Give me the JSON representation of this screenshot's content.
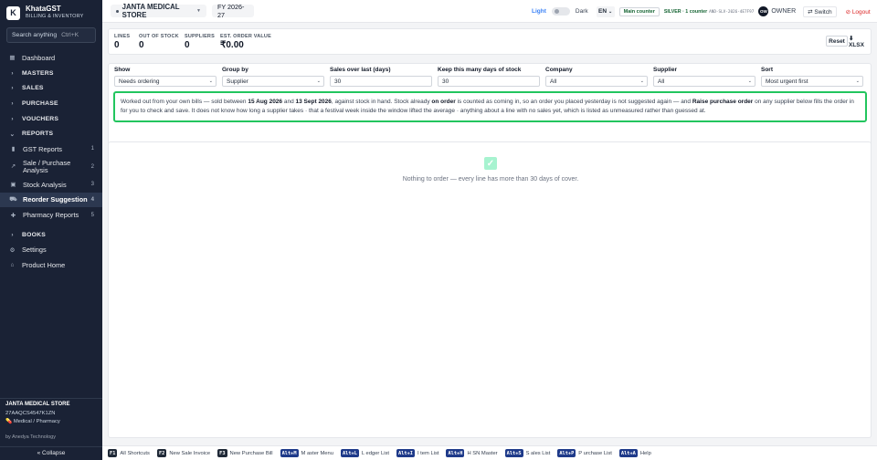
{
  "brand": {
    "logo": "K",
    "name": "KhataGST",
    "subtitle": "BILLING & INVENTORY"
  },
  "sidebar": {
    "search_placeholder": "Search anything",
    "search_shortcut": "Ctrl+K",
    "items": [
      {
        "label": "Dashboard",
        "icon": "grid-icon"
      },
      {
        "label": "MASTERS",
        "icon": "chevron-right-icon"
      },
      {
        "label": "SALES",
        "icon": "chevron-right-icon"
      },
      {
        "label": "PURCHASE",
        "icon": "chevron-right-icon"
      },
      {
        "label": "VOUCHERS",
        "icon": "chevron-right-icon"
      },
      {
        "label": "REPORTS",
        "icon": "chevron-down-icon"
      },
      {
        "label": "GST Reports",
        "count": "1",
        "icon": "bar-chart-icon"
      },
      {
        "label": "Sale / Purchase Analysis",
        "count": "2",
        "icon": "trend-icon"
      },
      {
        "label": "Stock Analysis",
        "count": "3",
        "icon": "box-icon"
      },
      {
        "label": "Reorder Suggestion",
        "count": "4",
        "icon": "cart-icon"
      },
      {
        "label": "Pharmacy Reports",
        "count": "5",
        "icon": "pill-icon"
      },
      {
        "label": "BOOKS",
        "icon": "chevron-right-icon"
      },
      {
        "label": "Settings",
        "icon": "gear-icon"
      },
      {
        "label": "Product Home",
        "icon": "home-icon"
      }
    ],
    "store": {
      "name": "JANTA MEDICAL STORE",
      "gstin": "27AAQCS4547K1ZN",
      "category": "Medical / Pharmacy"
    },
    "by_line": "by Anedya Technology",
    "collapse_label": "« Collapse"
  },
  "topbar": {
    "store_name": "JANTA MEDICAL STORE",
    "fy": "FY 2026-27",
    "light_label": "Light",
    "dark_label": "Dark",
    "lang": "EN",
    "counter_label": "Main counter",
    "license_text": "SILVER · 1 counter",
    "license_key": "AND-SLV-2026-4E7F97",
    "avatar_initials": "OW",
    "role": "OWNER",
    "switch_label": "⇄ Switch",
    "logout_label": "⊘ Logout"
  },
  "stats": [
    {
      "label": "LINES",
      "value": "0"
    },
    {
      "label": "OUT OF STOCK",
      "value": "0"
    },
    {
      "label": "SUPPLIERS",
      "value": "0"
    },
    {
      "label": "EST. ORDER VALUE",
      "value": "₹0.00"
    }
  ],
  "actions": {
    "reset": "Reset",
    "xlsx": "⬇ XLSX"
  },
  "filters": [
    {
      "label": "Show",
      "value": "Needs ordering",
      "select": true
    },
    {
      "label": "Group by",
      "value": "Supplier",
      "select": true
    },
    {
      "label": "Sales over last (days)",
      "value": "30",
      "select": false
    },
    {
      "label": "Keep this many days of stock",
      "value": "30",
      "select": false
    },
    {
      "label": "Company",
      "value": "All",
      "select": true
    },
    {
      "label": "Supplier",
      "value": "All",
      "select": true
    },
    {
      "label": "Sort",
      "value": "Most urgent first",
      "select": true
    }
  ],
  "notice": {
    "t1": "Worked out from your own bills — sold between ",
    "d1": "15 Aug 2026",
    "t2": " and ",
    "d2": "13 Sept 2026",
    "t3": ", against stock in hand. Stock already ",
    "b1": "on order",
    "t4": " is counted as coming in, so an order you placed yesterday is not suggested again — and ",
    "b2": "Raise purchase order",
    "t5": " on any supplier below fills the order in for you to check and save. It does not know how long a supplier takes · that a festival week inside the window lifted the average · anything about a line with no sales yet, which is listed as unmeasured rather than guessed at."
  },
  "empty_state": {
    "icon": "check-icon",
    "text": "Nothing to order — every line has more than 30 days of cover."
  },
  "shortcuts": [
    {
      "key": "F1",
      "action": "All Shortcuts",
      "alt": false
    },
    {
      "key": "F2",
      "action": "New Sale Invoice",
      "alt": false
    },
    {
      "key": "F3",
      "action": "New Purchase Bill",
      "alt": false
    },
    {
      "key": "Alt+M",
      "action": "M aster Menu",
      "alt": true
    },
    {
      "key": "Alt+L",
      "action": "L edger List",
      "alt": true
    },
    {
      "key": "Alt+I",
      "action": "I tem List",
      "alt": true
    },
    {
      "key": "Alt+H",
      "action": "H SN Master",
      "alt": true
    },
    {
      "key": "Alt+S",
      "action": "S ales List",
      "alt": true
    },
    {
      "key": "Alt+P",
      "action": "P urchase List",
      "alt": true
    },
    {
      "key": "Alt+A",
      "action": "Help",
      "alt": true
    }
  ]
}
